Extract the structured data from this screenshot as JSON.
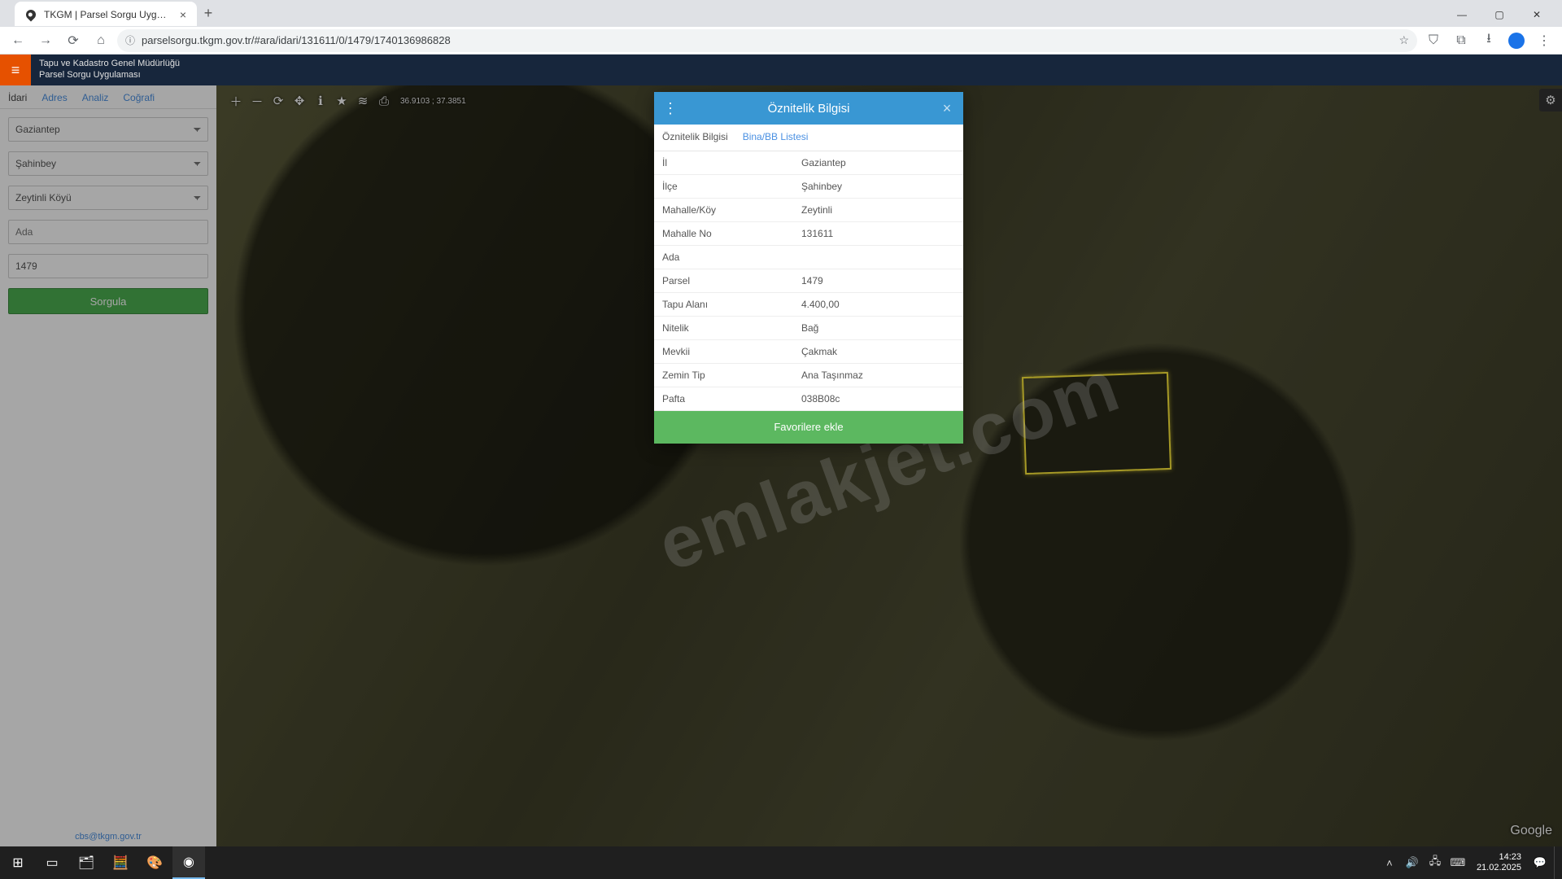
{
  "browser": {
    "tab_title": "TKGM | Parsel Sorgu Uygulaması",
    "url": "parselsorgu.tkgm.gov.tr/#ara/idari/131611/0/1479/1740136986828"
  },
  "app": {
    "org": "Tapu ve Kadastro Genel Müdürlüğü",
    "name": "Parsel Sorgu Uygulaması",
    "footer_email": "cbs@tkgm.gov.tr"
  },
  "sidebar": {
    "tabs": {
      "idari": "İdari",
      "adres": "Adres",
      "analiz": "Analiz",
      "cografi": "Coğrafi"
    },
    "il": "Gaziantep",
    "ilce": "Şahinbey",
    "mahalle": "Zeytinli Köyü",
    "ada_placeholder": "Ada",
    "parsel_value": "1479",
    "query_btn": "Sorgula"
  },
  "map": {
    "coords": "36.9103 ; 37.3851",
    "watermark": "emlakjet.com",
    "google": "Google"
  },
  "modal": {
    "title": "Öznitelik Bilgisi",
    "tab_attr": "Öznitelik Bilgisi",
    "tab_bina": "Bina/BB Listesi",
    "rows": {
      "il_k": "İl",
      "il_v": "Gaziantep",
      "ilce_k": "İlçe",
      "ilce_v": "Şahinbey",
      "mahalle_k": "Mahalle/Köy",
      "mahalle_v": "Zeytinli",
      "mahalleno_k": "Mahalle No",
      "mahalleno_v": "131611",
      "ada_k": "Ada",
      "ada_v": "",
      "parsel_k": "Parsel",
      "parsel_v": "1479",
      "alan_k": "Tapu Alanı",
      "alan_v": "4.400,00",
      "nitelik_k": "Nitelik",
      "nitelik_v": "Bağ",
      "mevkii_k": "Mevkii",
      "mevkii_v": "Çakmak",
      "zemin_k": "Zemin Tip",
      "zemin_v": "Ana Taşınmaz",
      "pafta_k": "Pafta",
      "pafta_v": "038B08c"
    },
    "favorite_btn": "Favorilere ekle"
  },
  "taskbar": {
    "time": "14:23",
    "date": "21.02.2025"
  }
}
